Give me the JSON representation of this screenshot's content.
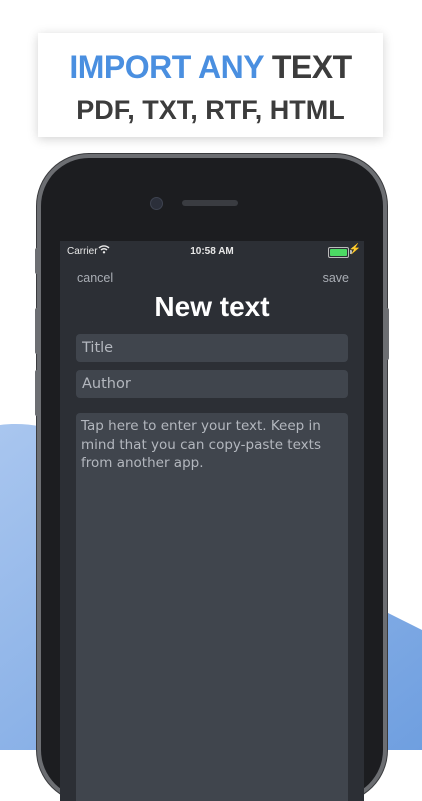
{
  "banner": {
    "line1_accent": "IMPORT ANY",
    "line1_rest": "TEXT",
    "line2": "PDF, TXT, RTF, HTML"
  },
  "colors": {
    "accent": "#4a8fe0",
    "background_wave": "#7aa6e3",
    "screen_bg": "#2c2f35",
    "field_bg": "#40454d",
    "battery": "#4cd964"
  },
  "status_bar": {
    "carrier": "Carrier",
    "time": "10:58 AM",
    "wifi_icon": "wifi-icon",
    "battery_icon": "battery-icon",
    "charging_icon": "bolt-icon",
    "battery_level": 1.0
  },
  "nav": {
    "cancel": "cancel",
    "save": "save"
  },
  "page": {
    "title": "New text"
  },
  "form": {
    "title_placeholder": "Title",
    "author_placeholder": "Author",
    "text_placeholder": "Tap here to enter your text. Keep in mind that you can copy-paste texts from another app."
  }
}
